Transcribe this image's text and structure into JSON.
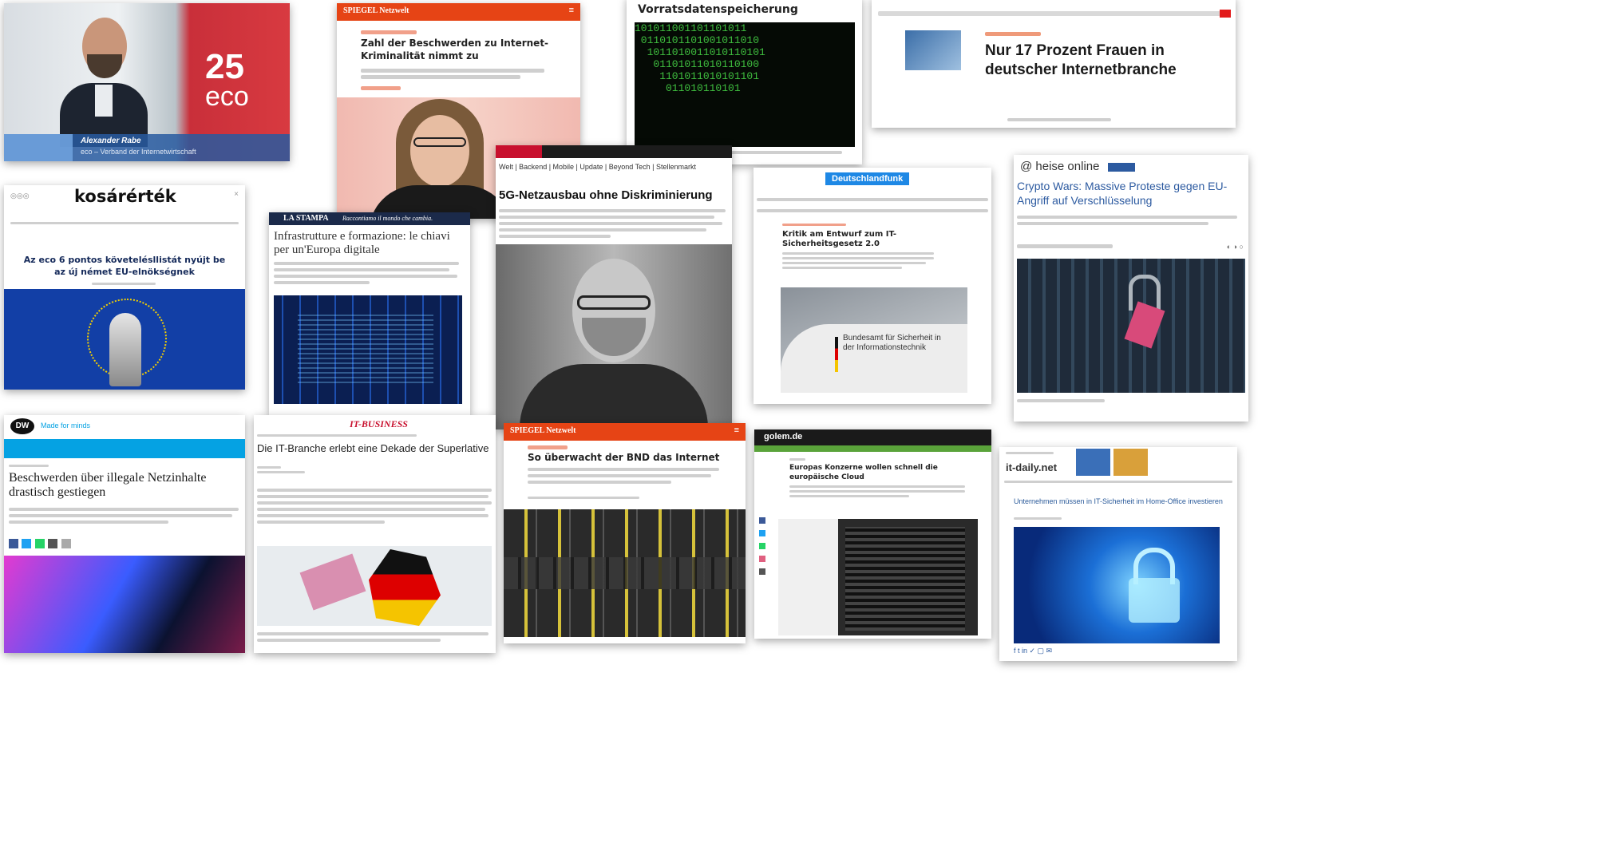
{
  "collage": {
    "c1": {
      "name": "Alexander Rabe",
      "role": "eco – Verband der Internetwirtschaft",
      "badge": "25",
      "badge_word": "eco"
    },
    "c2": {
      "brand": "SPIEGEL Netzwelt",
      "headline": "Zahl der Beschwerden zu Internet-Kriminalität nimmt zu"
    },
    "c3": {
      "headline": "Vorratsdatenspeicherung"
    },
    "c4": {
      "headline": "Nur 17 Prozent Frauen in deutscher Internetbranche"
    },
    "c5": {
      "brand": "kosárérték",
      "headline": "Az eco 6 pontos követelésllistát nyújt be az új német EU-elnökségnek"
    },
    "c6": {
      "brand": "LA STAMPA",
      "tagline": "Raccontiamo il mondo che cambia.",
      "headline": "Infrastrutture e formazione: le chiavi per un'Europa digitale"
    },
    "c7": {
      "headline": "5G-Netzausbau ohne Diskriminierung",
      "subnav": "Welt | Backend | Mobile | Update | Beyond Tech | Stellenmarkt"
    },
    "c8": {
      "brand": "Deutschlandfunk",
      "headline": "Kritik am Entwurf zum IT-Sicherheitsgesetz 2.0",
      "sign": "Bundesamt für Sicherheit in der Informationstechnik"
    },
    "c9": {
      "brand": "heise online",
      "headline": "Crypto Wars: Massive Proteste gegen EU-Angriff auf Verschlüsselung"
    },
    "c10": {
      "brand": "DW",
      "tagline": "Made for minds",
      "headline": "Beschwerden über illegale Netzinhalte drastisch gestiegen"
    },
    "c11": {
      "brand": "IT-BUSINESS",
      "headline": "Die IT-Branche erlebt eine Dekade der Superlative"
    },
    "c12": {
      "brand": "SPIEGEL Netzwelt",
      "headline": "So überwacht der BND das Internet"
    },
    "c13": {
      "brand": "golem.de",
      "headline": "Europas Konzerne wollen schnell die europäische Cloud"
    },
    "c14": {
      "brand": "it-daily.net",
      "headline": "Unternehmen müssen in IT-Sicherheit im Home-Office investieren"
    }
  },
  "colors": {
    "spiegel": "#e64415",
    "dw_blue": "#05a2e3",
    "heise_blue": "#2c5aa0",
    "dlf_blue": "#1e88e5",
    "eu_blue": "#123fa6"
  }
}
